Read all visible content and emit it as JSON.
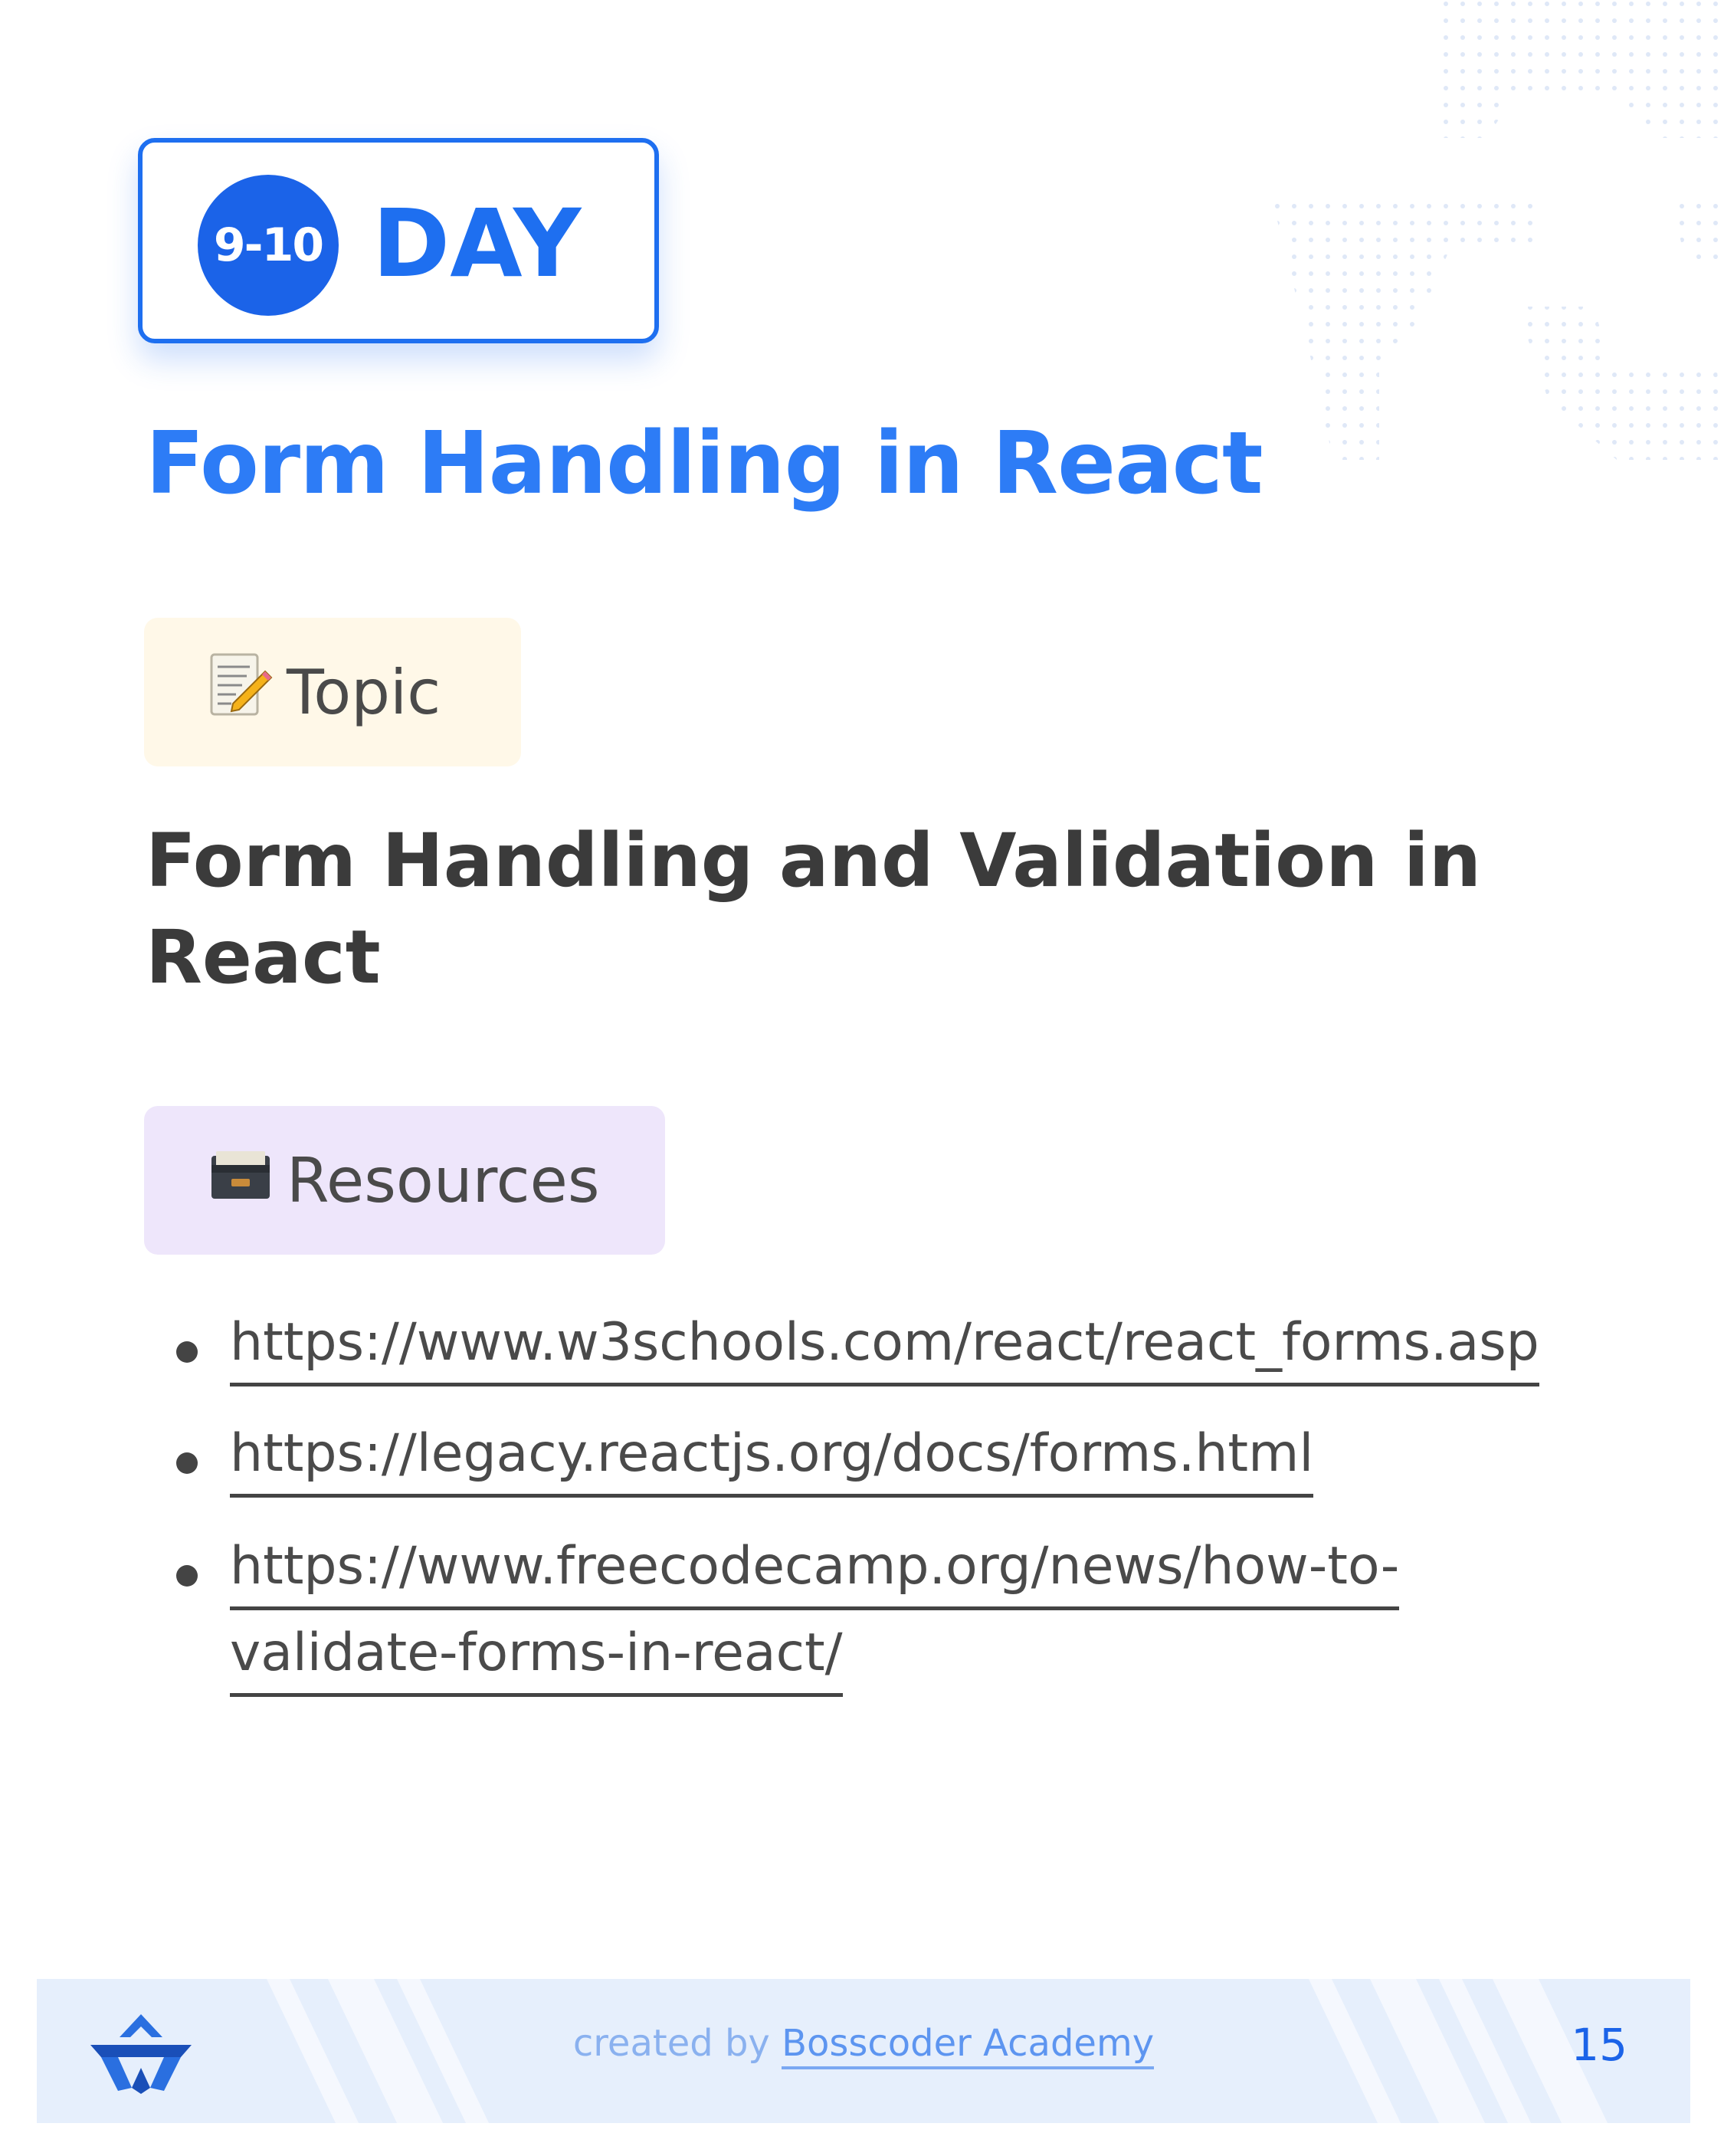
{
  "badge": {
    "day_number": "9-10",
    "day_label": "DAY"
  },
  "title": "Form Handling in React",
  "topic_section": {
    "icon": "memo-pencil-icon",
    "label": "Topic",
    "heading_line1": "Form Handling and Validation in",
    "heading_line2": "React"
  },
  "resources_section": {
    "icon": "card-file-box-icon",
    "label": "Resources",
    "links": [
      {
        "line1": "https://www.w3schools.com/react/react_forms.asp",
        "line2": ""
      },
      {
        "line1": "https://legacy.reactjs.org/docs/forms.html",
        "line2": ""
      },
      {
        "line1": "https://www.freecodecamp.org/news/how-to-",
        "line2": "validate-forms-in-react/"
      }
    ]
  },
  "footer": {
    "logo_icon": "bosscoder-logo-icon",
    "credit_prefix": "created by",
    "credit_brand": "Bosscoder Academy",
    "page_number": "15"
  },
  "colors": {
    "primary_blue": "#1e6ff0",
    "title_blue": "#2d7cf6",
    "text_dark": "#3b3b3b",
    "topic_bg": "#fff8e8",
    "resources_bg": "#eee6fb",
    "footer_bg": "#e6effc"
  }
}
